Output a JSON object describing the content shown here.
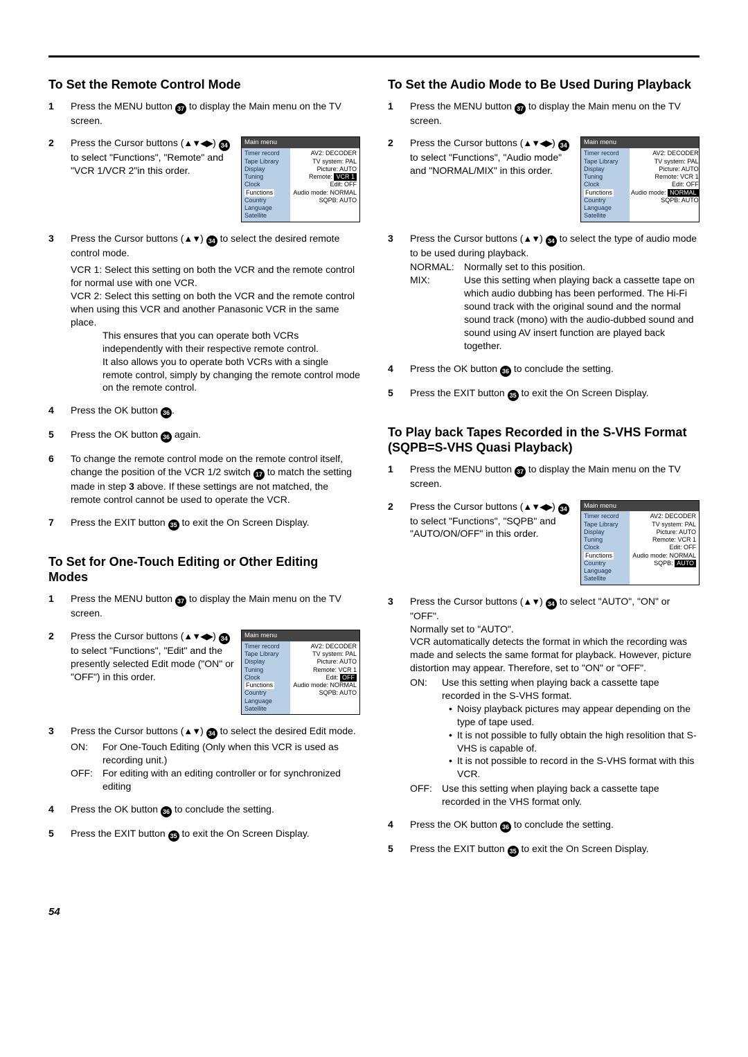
{
  "page_number": "54",
  "refs": {
    "r17": "17",
    "r34": "34",
    "r35": "35",
    "r36": "36",
    "r37": "37"
  },
  "arrows_udlr": "▲▼◀▶",
  "arrows_ud": "▲▼",
  "menu": {
    "title": "Main menu",
    "left_items": [
      "Timer record",
      "Tape Library",
      "Display",
      "Tuning",
      "Clock",
      "Functions",
      "Country",
      "Language",
      "Satellite"
    ],
    "right_items": [
      {
        "label": "AV2:",
        "value": "DECODER"
      },
      {
        "label": "TV system:",
        "value": "PAL"
      },
      {
        "label": "Picture:",
        "value": "AUTO"
      },
      {
        "label": "Remote:",
        "value": "VCR 1"
      },
      {
        "label": "Edit:",
        "value": "OFF"
      },
      {
        "label": "Audio mode:",
        "value": "NORMAL"
      },
      {
        "label": "SQPB:",
        "value": "AUTO"
      }
    ]
  },
  "remote": {
    "heading": "To Set the Remote Control Mode",
    "s1": "Press the MENU button ",
    "s1b": " to display the Main menu on the TV screen.",
    "s2a": "Press the Cursor buttons (",
    "s2b": ") ",
    "s2c": " to select \"Functions\", \"Remote\" and \"VCR 1/VCR 2\"in this order.",
    "s3a": "Press the Cursor buttons (",
    "s3b": ") ",
    "s3c": " to select the desired remote control mode.",
    "vcr1": "VCR 1: Select this setting on both the VCR and the remote control for normal use with one VCR.",
    "vcr2a": "VCR 2: Select this setting on both the VCR and the remote control when using this VCR and another Panasonic VCR in the same place.",
    "vcr2b": "This ensures that you can operate both VCRs independently with their respective remote control.",
    "vcr2c": "It also allows you to operate both VCRs with a single remote control, simply by changing the remote control mode on the remote control.",
    "s4a": "Press the OK button ",
    "s4b": ".",
    "s5a": "Press the OK button ",
    "s5b": " again.",
    "s6a": "To change the remote control mode on the remote control itself, change the position of the VCR 1/2 switch ",
    "s6b": " to match the setting made in step ",
    "s6_boldnum": "3",
    "s6c": " above. If these settings are not matched, the remote control cannot be used to operate the VCR.",
    "s7a": "Press the EXIT button ",
    "s7b": " to exit the On Screen Display."
  },
  "edit": {
    "heading": "To Set for One-Touch Editing or Other Editing Modes",
    "s1": "Press the MENU button ",
    "s1b": " to display the Main menu on the TV screen.",
    "s2a": "Press the Cursor buttons (",
    "s2b": ") ",
    "s2c": " to select \"Functions\", \"Edit\" and the presently selected Edit mode (\"ON\" or \"OFF\") in this order.",
    "s3a": "Press the Cursor buttons (",
    "s3b": ") ",
    "s3c": " to select the desired Edit mode.",
    "on_lbl": "ON:",
    "on": "For One-Touch Editing (Only when this VCR is used as recording unit.)",
    "off_lbl": "OFF:",
    "off": "For editing with an editing controller or for synchronized editing",
    "s4a": "Press the OK button ",
    "s4b": " to conclude the setting.",
    "s5a": "Press the EXIT button ",
    "s5b": " to exit the On Screen Display."
  },
  "audio": {
    "heading": "To Set the Audio Mode to Be Used During Playback",
    "s1": "Press the MENU button ",
    "s1b": " to display the Main menu on the TV screen.",
    "s2a": "Press the Cursor buttons (",
    "s2b": ") ",
    "s2c": " to select \"Functions\", \"Audio mode\" and \"NORMAL/MIX\" in this order.",
    "s3a": "Press the Cursor buttons (",
    "s3b": ") ",
    "s3c": " to select the type of audio mode to be used during playback.",
    "normal_lbl": "NORMAL:",
    "normal": "Normally set to this position.",
    "mix_lbl": "MIX:",
    "mix": "Use this setting when playing back a cassette tape on which audio dubbing has been performed. The Hi-Fi sound track with the original sound and the normal sound track (mono) with the audio-dubbed sound and sound using AV insert function are played back together.",
    "s4a": "Press the OK button ",
    "s4b": " to conclude the setting.",
    "s5a": "Press the EXIT button ",
    "s5b": " to exit the On Screen Display."
  },
  "svhs": {
    "heading": "To Play back Tapes Recorded in the S-VHS Format",
    "heading2": "(SQPB=S-VHS Quasi Playback)",
    "s1": "Press the MENU button ",
    "s1b": " to display the Main menu on the TV screen.",
    "s2a": "Press the Cursor buttons (",
    "s2b": ") ",
    "s2c": " to select \"Functions\", \"SQPB\" and \"AUTO/ON/OFF\" in this order.",
    "s3a": "Press the Cursor buttons (",
    "s3b": ") ",
    "s3c": " to select \"AUTO\", \"ON\" or \"OFF\".",
    "s3d": "Normally set to \"AUTO\".",
    "s3e": "VCR automatically detects the format in which the recording was made and selects the same format for playback. However, picture distortion may appear. Therefore, set to \"ON\" or \"OFF\".",
    "on_lbl": "ON:",
    "on": "Use this setting when playing back a cassette tape recorded in the S-VHS format.",
    "on_b1": "Noisy playback pictures may appear depending on the type of tape used.",
    "on_b2": "It is not possible to fully obtain the high resolition that S-VHS is capable of.",
    "on_b3": "It is not possible to record in the S-VHS format with this VCR.",
    "off_lbl": "OFF:",
    "off": "Use this setting when playing back a cassette tape recorded in the VHS format only.",
    "s4a": "Press the OK button ",
    "s4b": " to conclude the setting.",
    "s5a": "Press the EXIT button ",
    "s5b": " to exit the On Screen Display."
  }
}
